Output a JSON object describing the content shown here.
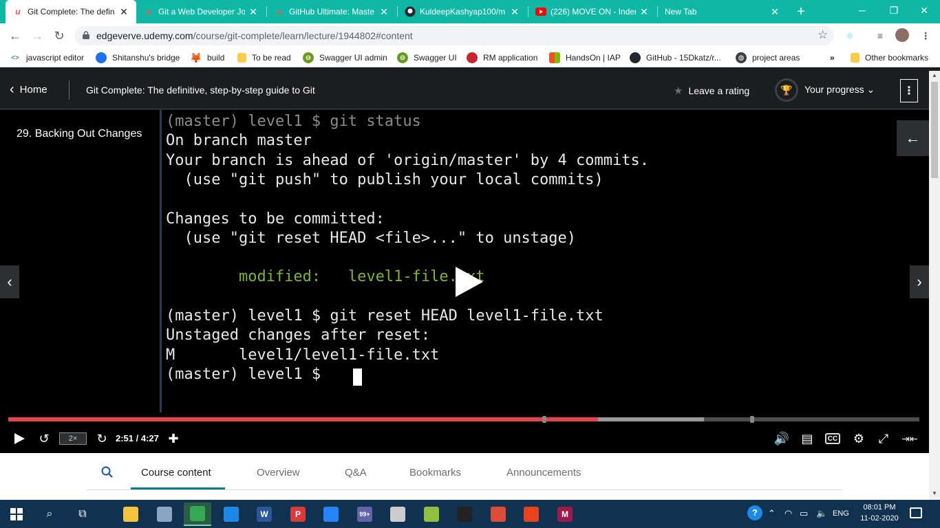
{
  "browser": {
    "tabs": [
      {
        "title": "Git Complete: The defin",
        "icon": "udemy-icon"
      },
      {
        "title": "Git a Web Developer Jo",
        "icon": "udemy-icon"
      },
      {
        "title": "GitHub Ultimate: Maste",
        "icon": "udemy-icon"
      },
      {
        "title": "KuldeepKashyap100/m",
        "icon": "github-icon"
      },
      {
        "title": "(226) MOVE ON - Inden",
        "icon": "youtube-icon"
      },
      {
        "title": "New Tab",
        "icon": ""
      }
    ],
    "new_tab": "+",
    "close_glyph": "✕",
    "url": {
      "host": "edgeverve.udemy.com",
      "path": "/course/git-complete/learn/lecture/1944802#content"
    },
    "bookmarks": [
      {
        "label": "javascript editor",
        "icon": "code-icon",
        "color": "#3aa757"
      },
      {
        "label": "Shitanshu's bridge",
        "icon": "browser-icon",
        "color": "#1a73e8"
      },
      {
        "label": "build",
        "icon": "gitlab-icon",
        "color": "#e24329"
      },
      {
        "label": "To be read",
        "icon": "folder-icon",
        "color": "#f9cc4a"
      },
      {
        "label": "Swagger UI admin",
        "icon": "swagger-icon",
        "color": "#6a9a1f"
      },
      {
        "label": "Swagger UI",
        "icon": "swagger-icon",
        "color": "#6a9a1f"
      },
      {
        "label": "RM application",
        "icon": "app-icon",
        "color": "#c6262e"
      },
      {
        "label": "HandsOn | IAP",
        "icon": "microsoft-icon",
        "color": "#f25022"
      },
      {
        "label": "GitHub - 15Dkatz/r...",
        "icon": "github-icon",
        "color": "#24292e"
      },
      {
        "label": "project areas",
        "icon": "globe-icon",
        "color": "#3c4043"
      },
      {
        "label": "»",
        "icon": "",
        "color": ""
      },
      {
        "label": "Other bookmarks",
        "icon": "folder-icon",
        "color": "#f9cc4a"
      }
    ]
  },
  "udemy": {
    "home_label": "Home",
    "course_title": "Git Complete: The definitive, step-by-step guide to Git",
    "rating_label": "Leave a rating",
    "progress_label": "Your progress",
    "lecture_title": "29. Backing Out Changes"
  },
  "terminal": {
    "lines": [
      {
        "text": "(master) level1 $ git status",
        "style": "dim"
      },
      {
        "text": "On branch master",
        "style": "normal"
      },
      {
        "text": "Your branch is ahead of 'origin/master' by 4 commits.",
        "style": "normal"
      },
      {
        "text": "  (use \"git push\" to publish your local commits)",
        "style": "normal"
      },
      {
        "text": "",
        "style": "normal"
      },
      {
        "text": "Changes to be committed:",
        "style": "normal"
      },
      {
        "text": "  (use \"git reset HEAD <file>...\" to unstage)",
        "style": "normal"
      },
      {
        "text": "",
        "style": "normal"
      },
      {
        "text": "        modified:   level1-file.txt",
        "style": "green"
      },
      {
        "text": "",
        "style": "normal"
      },
      {
        "text": "(master) level1 $ git reset HEAD level1-file.txt",
        "style": "normal"
      },
      {
        "text": "Unstaged changes after reset:",
        "style": "normal"
      },
      {
        "text": "M       level1/level1-file.txt",
        "style": "normal"
      },
      {
        "text": "(master) level1 $ ",
        "style": "normal"
      }
    ]
  },
  "player": {
    "speed": "2×",
    "time": "2:51 / 4:27",
    "played_fraction": 0.6474,
    "buffered_fraction": 0.7634,
    "cc_label": "CC"
  },
  "course_tabs": [
    "Course content",
    "Overview",
    "Q&A",
    "Bookmarks",
    "Announcements"
  ],
  "taskbar": {
    "apps": [
      {
        "name": "file-explorer-icon",
        "label": "",
        "color": "#f5c542"
      },
      {
        "name": "snipping-tool-icon",
        "label": "",
        "color": "#8aa4c4"
      },
      {
        "name": "chrome-icon",
        "label": "",
        "color": "#34a853"
      },
      {
        "name": "vscode-icon",
        "label": "",
        "color": "#1e88e5"
      },
      {
        "name": "word-icon",
        "label": "W",
        "color": "#2b579a"
      },
      {
        "name": "postman-icon",
        "label": "P",
        "color": "#d93a3a"
      },
      {
        "name": "sourcetree-icon",
        "label": "",
        "color": "#2684ff"
      },
      {
        "name": "teams-icon",
        "label": "99+",
        "color": "#6264a7"
      },
      {
        "name": "eclipse-icon",
        "label": "",
        "color": "#cccccc"
      },
      {
        "name": "notepad-plus-icon",
        "label": "",
        "color": "#90c040"
      },
      {
        "name": "terminal-icon",
        "label": "",
        "color": "#222222"
      },
      {
        "name": "chrome-icon",
        "label": "",
        "color": "#dd4b39"
      },
      {
        "name": "office-icon",
        "label": "",
        "color": "#e8431c"
      },
      {
        "name": "mendeley-icon",
        "label": "M",
        "color": "#9b1c4b"
      }
    ],
    "lang": "ENG",
    "time": "08:01 PM",
    "date": "11-02-2020"
  },
  "colors": {
    "tabstrip": "#0fb8a6",
    "udemy_dark": "#1c1d1f",
    "progress_red": "#e0454e",
    "taskbar": "#10314f"
  }
}
